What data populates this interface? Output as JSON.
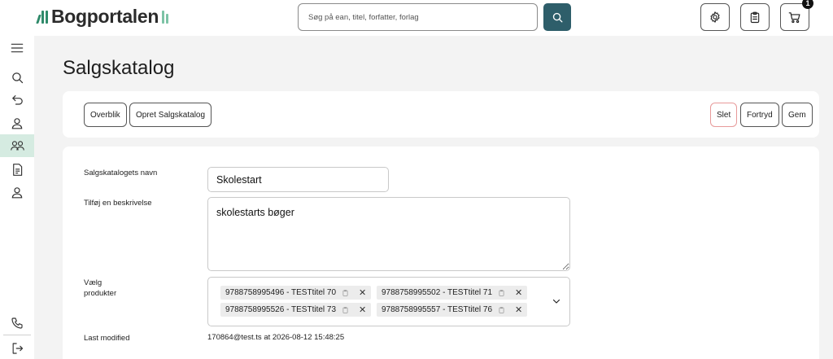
{
  "header": {
    "logo_text": "Bogportalen",
    "search_placeholder": "Søg på ean, titel, forfatter, forlag",
    "cart_count": "1"
  },
  "sidebar": {
    "items": [
      {
        "icon": "menu-icon"
      },
      {
        "icon": "search-icon"
      },
      {
        "icon": "undo-icon"
      },
      {
        "icon": "user-icon"
      },
      {
        "icon": "users-icon",
        "active": true
      },
      {
        "icon": "document-icon"
      },
      {
        "icon": "user-icon"
      },
      {
        "icon": "phone-icon"
      },
      {
        "icon": "logout-icon"
      }
    ]
  },
  "page": {
    "title": "Salgskatalog"
  },
  "toolbar": {
    "overview_label": "Overblik",
    "create_label": "Opret Salgskatalog",
    "delete_label": "Slet",
    "undo_label": "Fortryd",
    "save_label": "Gem"
  },
  "form": {
    "name_label": "Salgskatalogets navn",
    "name_value": "Skolestart",
    "description_label": "Tilføj en beskrivelse",
    "description_value": "skolestarts bøger",
    "products_label_line1": "Vælg",
    "products_label_line2": "produkter",
    "products": [
      "9788758995496 - TESTtitel 70",
      "9788758995502 - TESTtitel 71",
      "9788758995526 - TESTtitel 73",
      "9788758995557 - TESTtitel 76"
    ],
    "chip_remove_symbol": "✕",
    "modified_label": "Last modified",
    "modified_value": "170864@test.ts at 2026-08-12 15:48:25"
  },
  "colors": {
    "brand_green": "#2f8a6a",
    "search_button": "#2e5e6a",
    "active_nav": "#d5ebe1",
    "delete_border": "#e79a9a"
  }
}
